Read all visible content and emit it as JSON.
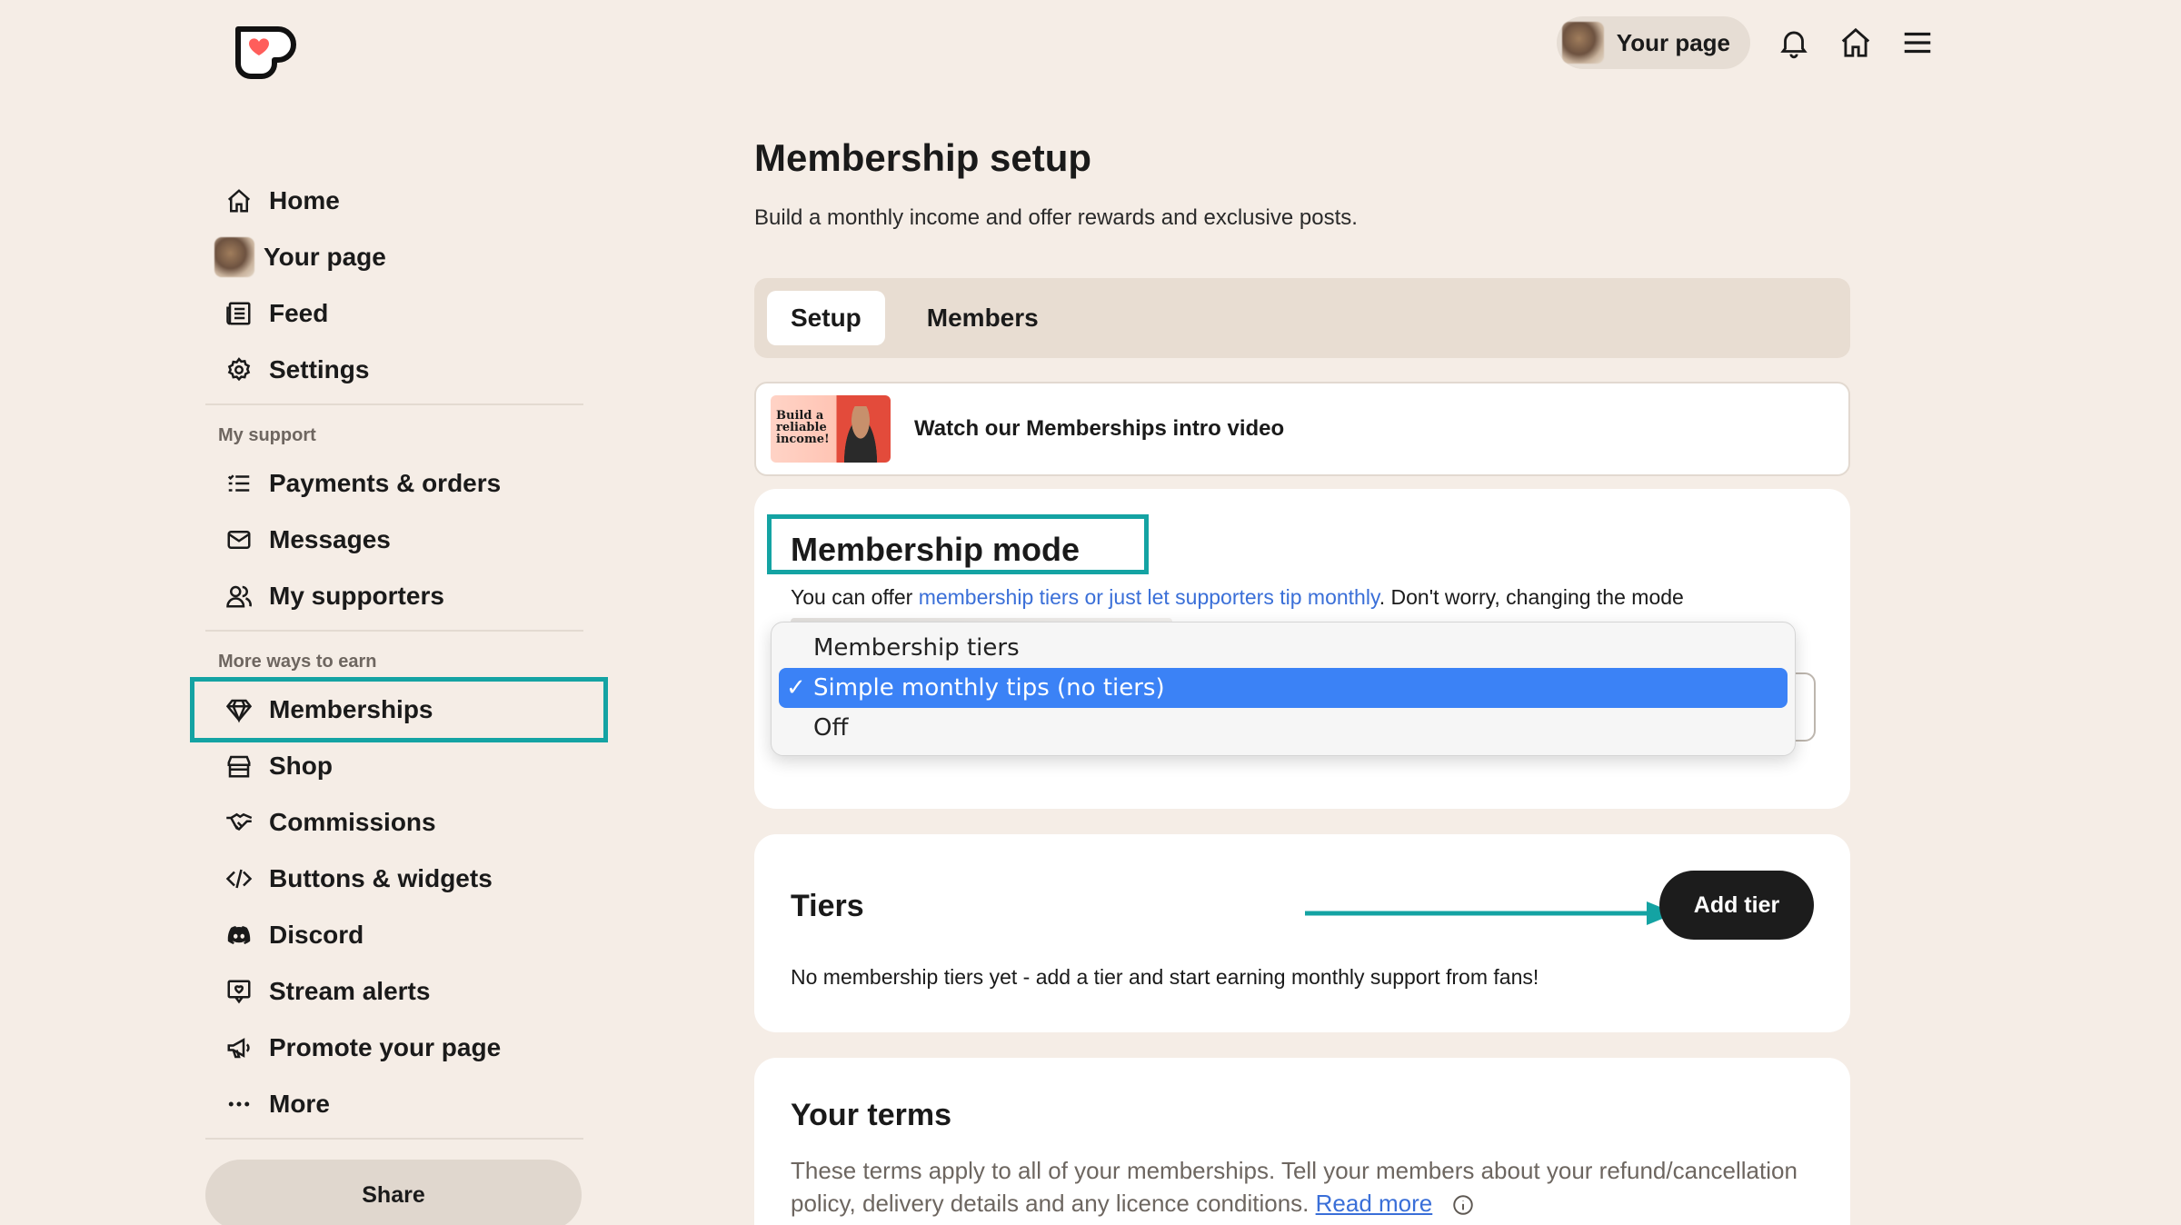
{
  "header": {
    "your_page_label": "Your page"
  },
  "sidebar": {
    "items": [
      {
        "label": "Home",
        "icon": "home-icon"
      },
      {
        "label": "Your page",
        "icon": "avatar"
      },
      {
        "label": "Feed",
        "icon": "feed-icon"
      },
      {
        "label": "Settings",
        "icon": "gear-icon"
      }
    ],
    "support_label": "My support",
    "support_items": [
      {
        "label": "Payments & orders",
        "icon": "list-icon"
      },
      {
        "label": "Messages",
        "icon": "mail-icon"
      },
      {
        "label": "My supporters",
        "icon": "supporters-icon"
      }
    ],
    "earn_label": "More ways to earn",
    "earn_items": [
      {
        "label": "Memberships",
        "icon": "gem-icon"
      },
      {
        "label": "Shop",
        "icon": "shop-icon"
      },
      {
        "label": "Commissions",
        "icon": "handshake-icon"
      },
      {
        "label": "Buttons & widgets",
        "icon": "code-icon"
      },
      {
        "label": "Discord",
        "icon": "discord-icon"
      },
      {
        "label": "Stream alerts",
        "icon": "stream-alert-icon"
      },
      {
        "label": "Promote your page",
        "icon": "megaphone-icon"
      },
      {
        "label": "More",
        "icon": "more-icon"
      }
    ],
    "share_label": "Share"
  },
  "main": {
    "title": "Membership setup",
    "subtitle": "Build a monthly income and offer rewards and exclusive posts.",
    "tabs": [
      {
        "label": "Setup",
        "active": true
      },
      {
        "label": "Members",
        "active": false
      }
    ],
    "video": {
      "label": "Watch our Memberships intro video",
      "thumb_text": "Build a reliable income!"
    },
    "mode": {
      "title": "Membership mode",
      "desc_prefix": "You can offer ",
      "desc_link": "membership tiers or just let supporters tip monthly",
      "desc_suffix": ". Don't worry, changing the mode",
      "options": [
        {
          "label": "Membership tiers",
          "selected": false
        },
        {
          "label": "Simple monthly tips (no tiers)",
          "selected": true
        },
        {
          "label": "Off",
          "selected": false
        }
      ],
      "check_mark": "✓"
    },
    "tiers": {
      "title": "Tiers",
      "add_label": "Add tier",
      "empty_text": "No membership tiers yet - add a tier and start earning monthly support from fans!"
    },
    "terms": {
      "title": "Your terms",
      "text": "These terms apply to all of your memberships. Tell your members about your refund/cancellation policy, delivery details and any licence conditions.",
      "read_more": "Read more"
    }
  },
  "colors": {
    "background": "#f5ede6",
    "highlight": "#14a3a3",
    "link": "#3a6fd8",
    "selected_option": "#3b82f6",
    "brand_red": "#ff5e5b"
  }
}
